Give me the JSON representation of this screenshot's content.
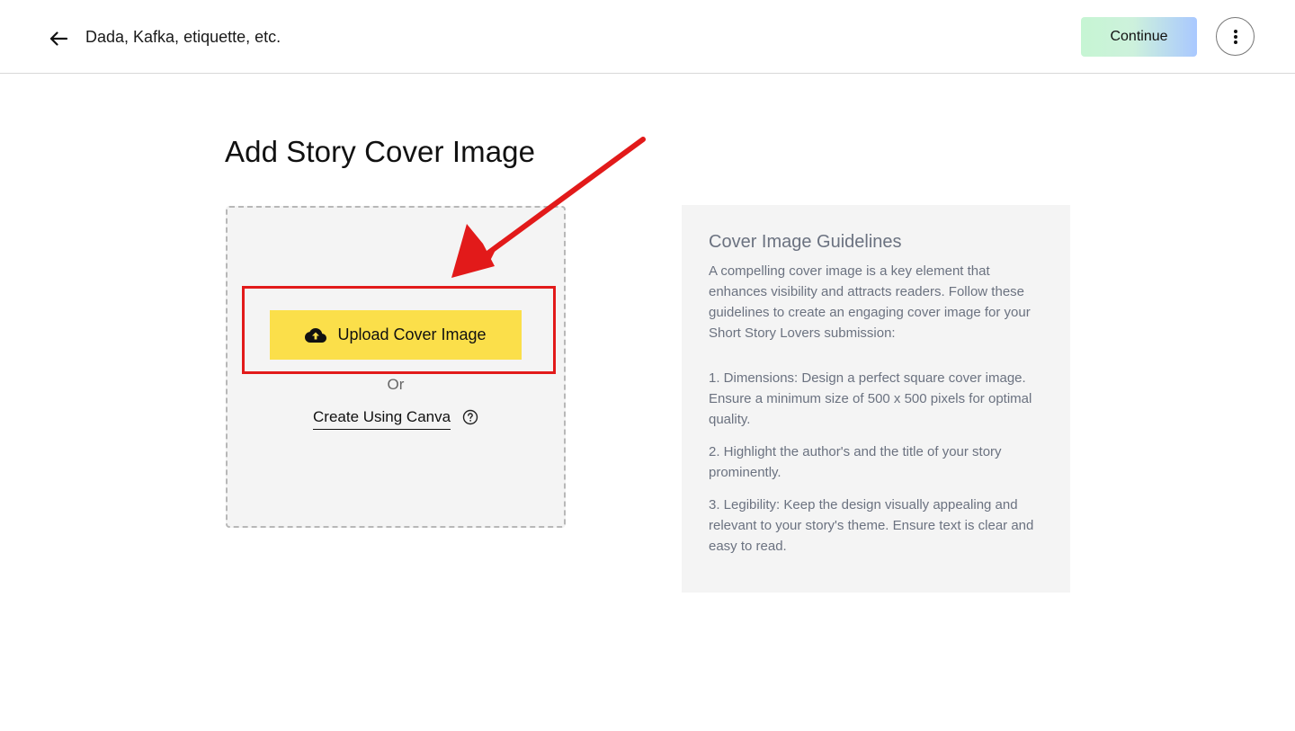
{
  "header": {
    "story_title": "Dada, Kafka, etiquette, etc.",
    "continue_label": "Continue",
    "back_icon": "arrow-left-icon",
    "more_icon": "more-vertical-icon"
  },
  "main": {
    "title": "Add Story Cover Image",
    "upload_label": "Upload Cover Image",
    "upload_icon": "cloud-upload-icon",
    "or_label": "Or",
    "canva_label": "Create Using Canva",
    "help_icon": "question-circle-icon"
  },
  "guidelines": {
    "heading": "Cover Image Guidelines",
    "intro": "A compelling cover image is a key element that enhances visibility and attracts readers. Follow these guidelines to create an engaging cover image for your Short Story Lovers submission:",
    "rules": [
      "1. Dimensions: Design a perfect square cover image. Ensure a minimum size of 500 x 500 pixels for optimal quality.",
      "2. Highlight the author's and the title of your story prominently.",
      "3. Legibility: Keep the design visually appealing and relevant to your story's theme. Ensure text is clear and easy to read."
    ]
  },
  "colors": {
    "upload_button": "#fbdf4a",
    "annotation_red": "#e21a1a",
    "panel_background": "#f4f4f4",
    "guideline_text": "#6b7280"
  }
}
